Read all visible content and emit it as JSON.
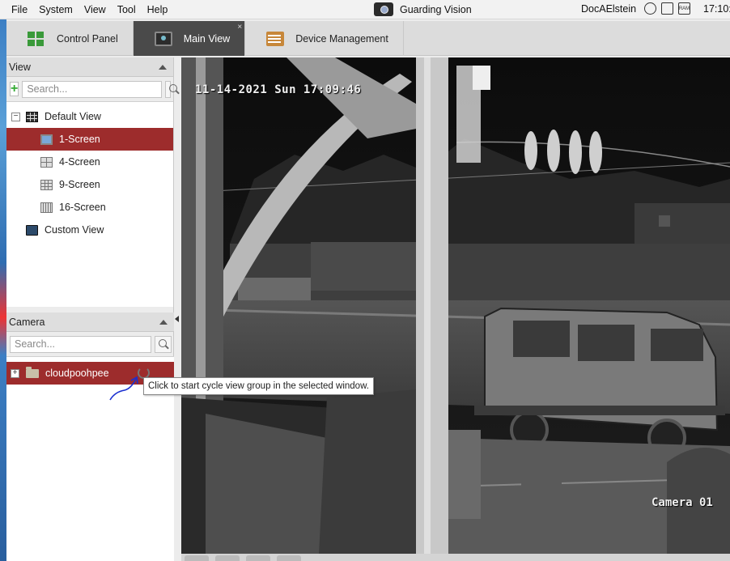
{
  "menu": {
    "items": [
      "File",
      "System",
      "View",
      "Tool",
      "Help"
    ],
    "app_title": "Guarding Vision",
    "user": "DocAElstein",
    "clock": "17:10:",
    "ram_badge": "RAM"
  },
  "tabs": [
    {
      "label": "Control Panel",
      "icon": "control-panel-icon"
    },
    {
      "label": "Main View",
      "icon": "main-view-icon",
      "active": true,
      "close": "×"
    },
    {
      "label": "Device Management",
      "icon": "device-management-icon"
    }
  ],
  "view_panel": {
    "title": "View",
    "add_label": "+",
    "search_placeholder": "Search...",
    "tree": {
      "root": {
        "label": "Default View",
        "expander": "−"
      },
      "items": [
        {
          "label": "1-Screen",
          "selected": true
        },
        {
          "label": "4-Screen"
        },
        {
          "label": "9-Screen"
        },
        {
          "label": "16-Screen"
        }
      ],
      "custom": {
        "label": "Custom View"
      }
    }
  },
  "camera_panel": {
    "title": "Camera",
    "search_placeholder": "Search...",
    "group": {
      "label": "cloudpoohpee",
      "expander": "+"
    }
  },
  "tooltip": "Click to start cycle view group in the selected window.",
  "video": {
    "timestamp": "11-14-2021 Sun 17:09:46",
    "camera_name": "Camera 01"
  },
  "colors": {
    "selection": "#9d2c2c",
    "active_tab": "#4a4a4a"
  }
}
